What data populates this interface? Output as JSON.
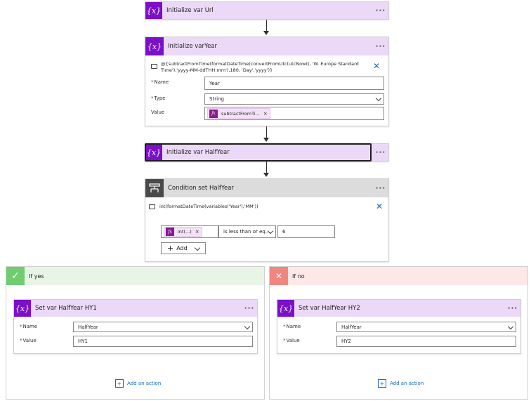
{
  "steps": {
    "init_url": {
      "title": "Initialize var Url",
      "icon": "variable-icon"
    },
    "init_year": {
      "title": "Initialize varYear",
      "expression_line1": "@{subtractFromTime(formatDateTime(convertFromUtc(utcNow(), 'W. Europe Standard",
      "expression_line2": "Time'),'yyyy-MM-ddTHH:mm'),180, 'Day','yyyy')}",
      "name_label": "Name",
      "name_value": "Year",
      "type_label": "Type",
      "type_value": "String",
      "value_label": "Value",
      "value_token": "subtractFromTi..."
    },
    "init_halfyear": {
      "title": "Initialize var HalfYear"
    },
    "condition": {
      "title": "Condition set HalfYear",
      "expression": "int(formatDateTime(variables('Year'),'MM'))",
      "left_token": "int(...)",
      "operator": "is less than or eq...",
      "right_value": "6",
      "add_label": "Add"
    }
  },
  "branches": {
    "yes": {
      "title": "If yes",
      "action_title": "Set var HalfYear HY1",
      "name_label": "Name",
      "name_value": "HalfYear",
      "value_label": "Value",
      "value_value": "HY1",
      "add_action": "Add an action"
    },
    "no": {
      "title": "If no",
      "action_title": "Set var HalfYear HY2",
      "name_label": "Name",
      "name_value": "HalfYear",
      "value_label": "Value",
      "value_value": "HY2",
      "add_action": "Add an action"
    }
  },
  "ui": {
    "more_glyph": "···",
    "var_glyph": "{x}",
    "fx_glyph": "fx",
    "close_glyph": "✕",
    "token_remove_glyph": "×",
    "required_glyph": "*",
    "check_glyph": "✓",
    "cross_glyph": "✕",
    "plus_glyph": "+"
  },
  "colors": {
    "variable_accent": "#7b10c8",
    "variable_header": "#ebd9f7",
    "condition_header": "#dcdcdc",
    "yes_header": "#e8f5e6",
    "yes_accent": "#6fcc6f",
    "no_header": "#fde7e7",
    "no_accent": "#f1867f",
    "link": "#0f6cbd"
  }
}
